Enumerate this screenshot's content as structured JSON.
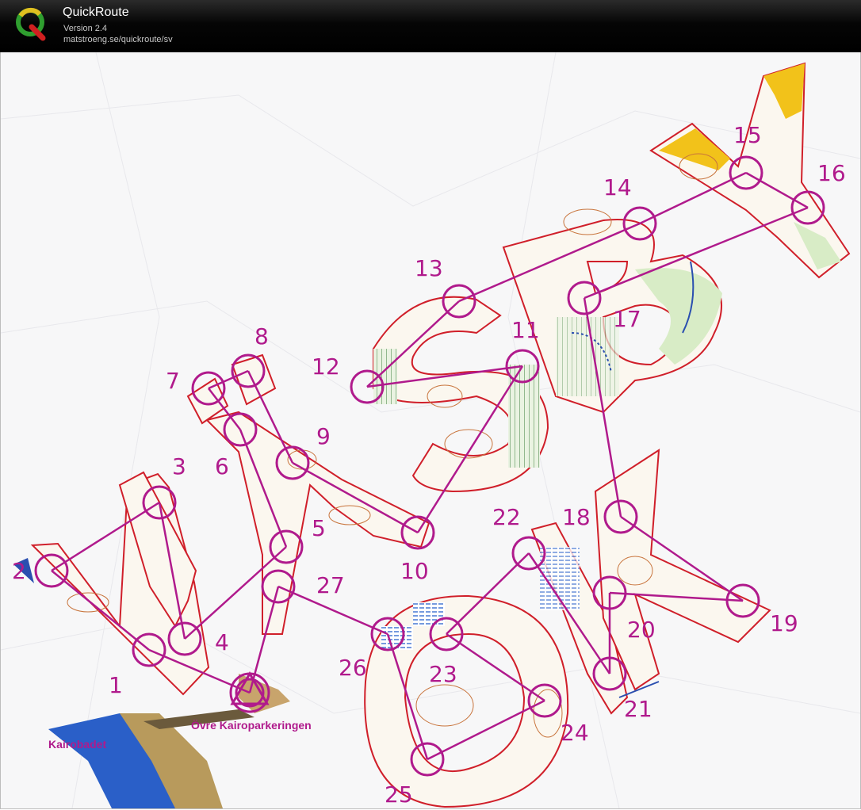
{
  "app": {
    "title": "QuickRoute",
    "version": "Version 2.4",
    "url": "matstroeng.se/quickroute/sv",
    "icon": "quickroute-logo-icon"
  },
  "map": {
    "course_color": "#b01a8c",
    "controls": [
      {
        "label": "1"
      },
      {
        "label": "2"
      },
      {
        "label": "3"
      },
      {
        "label": "4"
      },
      {
        "label": "5"
      },
      {
        "label": "6"
      },
      {
        "label": "7"
      },
      {
        "label": "8"
      },
      {
        "label": "9"
      },
      {
        "label": "10"
      },
      {
        "label": "11"
      },
      {
        "label": "12"
      },
      {
        "label": "13"
      },
      {
        "label": "14"
      },
      {
        "label": "15"
      },
      {
        "label": "16"
      },
      {
        "label": "17"
      },
      {
        "label": "18"
      },
      {
        "label": "19"
      },
      {
        "label": "20"
      },
      {
        "label": "21"
      },
      {
        "label": "22"
      },
      {
        "label": "23"
      },
      {
        "label": "24"
      },
      {
        "label": "25"
      },
      {
        "label": "26"
      },
      {
        "label": "27"
      }
    ],
    "place_names": {
      "parking": "Övre Kairoparkeringen",
      "beach": "Kairobadet"
    }
  }
}
